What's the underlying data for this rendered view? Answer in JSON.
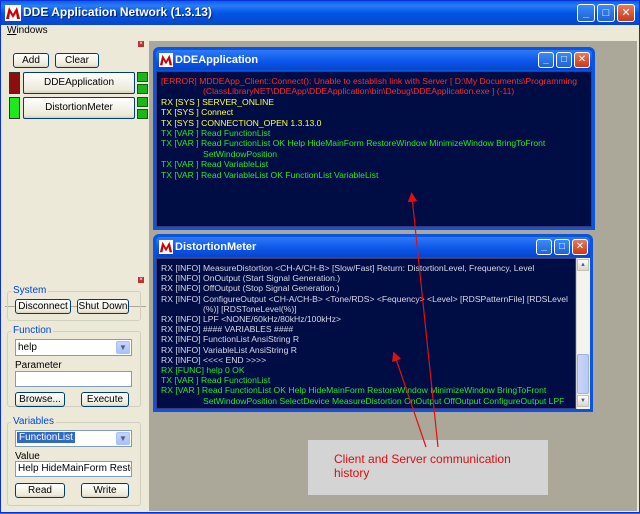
{
  "window": {
    "title": "DDE Application Network (1.3.13)"
  },
  "menu": {
    "windows": "Windows"
  },
  "toolbar": {
    "add": "Add",
    "clear": "Clear"
  },
  "apps": [
    {
      "name": "DDEApplication",
      "left_indicator": "#8b0f0f"
    },
    {
      "name": "DistortionMeter",
      "left_indicator": "#1ee81e"
    }
  ],
  "system": {
    "label": "System",
    "disconnect": "Disconnect",
    "shutdown": "Shut Down"
  },
  "function": {
    "label": "Function",
    "selected": "help",
    "parameter_label": "Parameter",
    "parameter_value": "",
    "browse": "Browse...",
    "execute": "Execute"
  },
  "variables": {
    "label": "Variables",
    "selected": "FunctionList",
    "value_label": "Value",
    "value": "Help HideMainForm RestoreWir",
    "read": "Read",
    "write": "Write"
  },
  "child_dde": {
    "title": "DDEApplication",
    "lines": [
      {
        "text": "[ERROR] MDDEApp_Client::Connect(): Unable to establish link with Server [ D:\\My Documents\\Programming",
        "color": "red",
        "indent": 0
      },
      {
        "text": "(ClassLibraryNET\\DDEApp\\DDEApplication\\bin\\Debug\\DDEApplication.exe ] (-11)",
        "color": "red",
        "indent": 1
      },
      {
        "text": "RX [SYS ]  SERVER_ONLINE",
        "color": "yellow",
        "indent": 0
      },
      {
        "text": "TX [SYS ]  Connect",
        "color": "yellow",
        "indent": 0
      },
      {
        "text": "TX [SYS ]  CONNECTION_OPEN 1.3.13.0",
        "color": "yellow",
        "indent": 0
      },
      {
        "text": "TX [VAR ]  Read FunctionList",
        "color": "green",
        "indent": 0
      },
      {
        "text": "TX [VAR ]  Read FunctionList OK Help HideMainForm RestoreWindow MinimizeWindow BringToFront",
        "color": "green",
        "indent": 0
      },
      {
        "text": "SetWindowPosition",
        "color": "green",
        "indent": 1
      },
      {
        "text": "TX [VAR ]  Read VariableList",
        "color": "green",
        "indent": 0
      },
      {
        "text": "TX [VAR ]  Read VariableList OK FunctionList VariableList",
        "color": "green",
        "indent": 0
      }
    ]
  },
  "child_dist": {
    "title": "DistortionMeter",
    "lines": [
      {
        "text": "RX [INFO]  MeasureDistortion <CH-A/CH-B> [Slow/Fast] Return: DistortionLevel, Frequency, Level",
        "color": "white",
        "indent": 0
      },
      {
        "text": "RX [INFO]  OnOutput (Start Signal Generation.)",
        "color": "white",
        "indent": 0
      },
      {
        "text": "RX [INFO]  OffOutput (Stop Signal Generation.)",
        "color": "white",
        "indent": 0
      },
      {
        "text": "RX [INFO]  ConfigureOutput <CH-A/CH-B> <Tone/RDS> <Fequency> <Level> [RDSPatternFile] [RDSLevel",
        "color": "white",
        "indent": 0
      },
      {
        "text": "(%)] [RDSToneLevel(%)]",
        "color": "white",
        "indent": 1
      },
      {
        "text": "RX [INFO]  LPF <NONE/60kHz/80kHz/100kHz>",
        "color": "white",
        "indent": 0
      },
      {
        "text": "RX [INFO]  #### VARIABLES ####",
        "color": "white",
        "indent": 0
      },
      {
        "text": "RX [INFO]  FunctionList AnsiString R",
        "color": "white",
        "indent": 0
      },
      {
        "text": "RX [INFO]  VariableList AnsiString R",
        "color": "white",
        "indent": 0
      },
      {
        "text": "RX [INFO]  <<<< END >>>>",
        "color": "white",
        "indent": 0
      },
      {
        "text": "RX [FUNC]  help 0 OK",
        "color": "green",
        "indent": 0
      },
      {
        "text": "TX [VAR ]  Read FunctionList",
        "color": "green",
        "indent": 0
      },
      {
        "text": "RX [VAR ]  Read FunctionList OK Help HideMainForm RestoreWindow MinimizeWindow BringToFront",
        "color": "green",
        "indent": 0
      },
      {
        "text": "SetWindowPosition SelectDevice MeasureDistortion OnOutput OffOutput ConfigureOutput LPF",
        "color": "green",
        "indent": 1
      }
    ]
  },
  "annotation": {
    "text": "Client and Server communication history"
  },
  "colors": {
    "title_blue": "#0a54e3",
    "console_bg": "#000d45",
    "error": "#ff2a2a",
    "sys": "#ffff40",
    "ok": "#28e828",
    "info": "#d8d8e8"
  }
}
